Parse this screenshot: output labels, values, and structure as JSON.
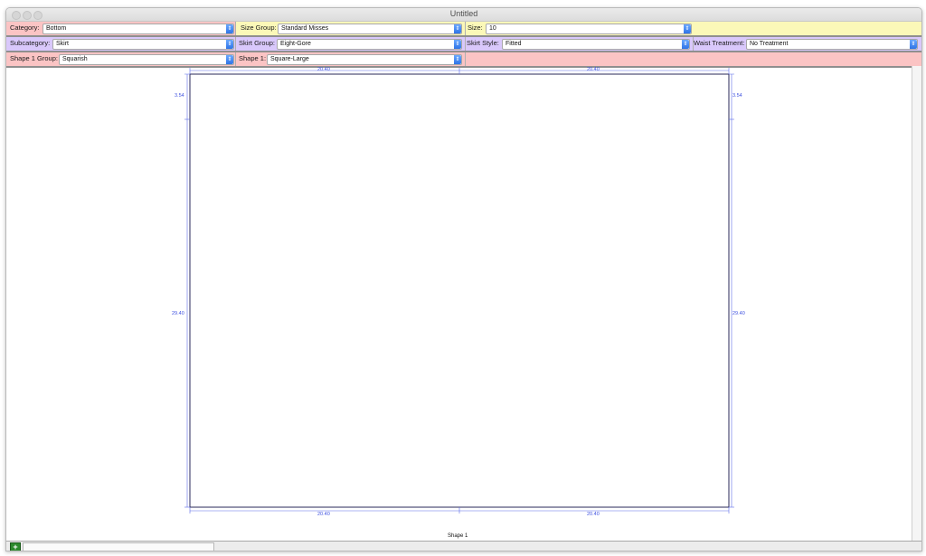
{
  "window": {
    "title": "Untitled"
  },
  "toolbar": {
    "row1": {
      "category": {
        "label": "Category:",
        "value": "Bottom"
      },
      "size_group": {
        "label": "Size Group:",
        "value": "Standard Misses"
      },
      "size": {
        "label": "Size:",
        "value": "10"
      }
    },
    "row2": {
      "subcategory": {
        "label": "Subcategory:",
        "value": "Skirt"
      },
      "skirt_group": {
        "label": "Skirt Group:",
        "value": "Eight-Gore"
      },
      "skirt_style": {
        "label": "Skirt Style:",
        "value": "Fitted"
      },
      "waist_treatment": {
        "label": "Waist Treatment:",
        "value": "No Treatment"
      }
    },
    "row3": {
      "shape1_group": {
        "label": "Shape 1 Group:",
        "value": "Squarish"
      },
      "shape1": {
        "label": "Shape 1:",
        "value": "Square-Large"
      }
    }
  },
  "canvas": {
    "top_dims": [
      "20.40",
      "20.40"
    ],
    "bottom_dims": [
      "20.40",
      "20.40"
    ],
    "left_dims": [
      "3.54",
      "29.40"
    ],
    "right_dims": [
      "3.54",
      "29.40"
    ],
    "shape_label": "Shape 1"
  },
  "statusbar": {
    "add_symbol": "+"
  }
}
